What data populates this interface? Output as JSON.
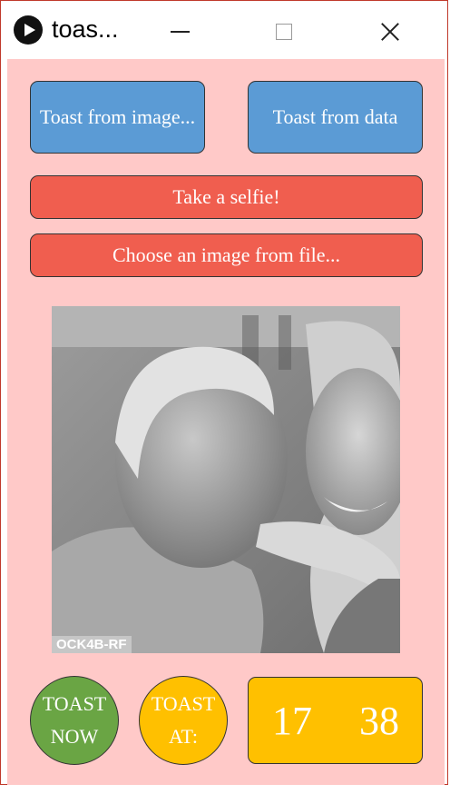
{
  "window": {
    "title": "toas..."
  },
  "buttons": {
    "toast_image": "Toast from image...",
    "toast_data": "Toast from data",
    "selfie": "Take a selfie!",
    "choose_file": "Choose an image from file..."
  },
  "photo": {
    "watermark": "OCK4B-RF"
  },
  "toast_now": {
    "line1": "TOAST",
    "line2": "NOW"
  },
  "toast_at": {
    "line1": "TOAST",
    "line2": "AT:"
  },
  "time": {
    "hour": "17",
    "minute": "38"
  },
  "colors": {
    "background": "#ffc9c8",
    "blue_button": "#5b9bd5",
    "red_button": "#f05e4f",
    "green_button": "#6aa544",
    "yellow_button": "#ffc000"
  }
}
